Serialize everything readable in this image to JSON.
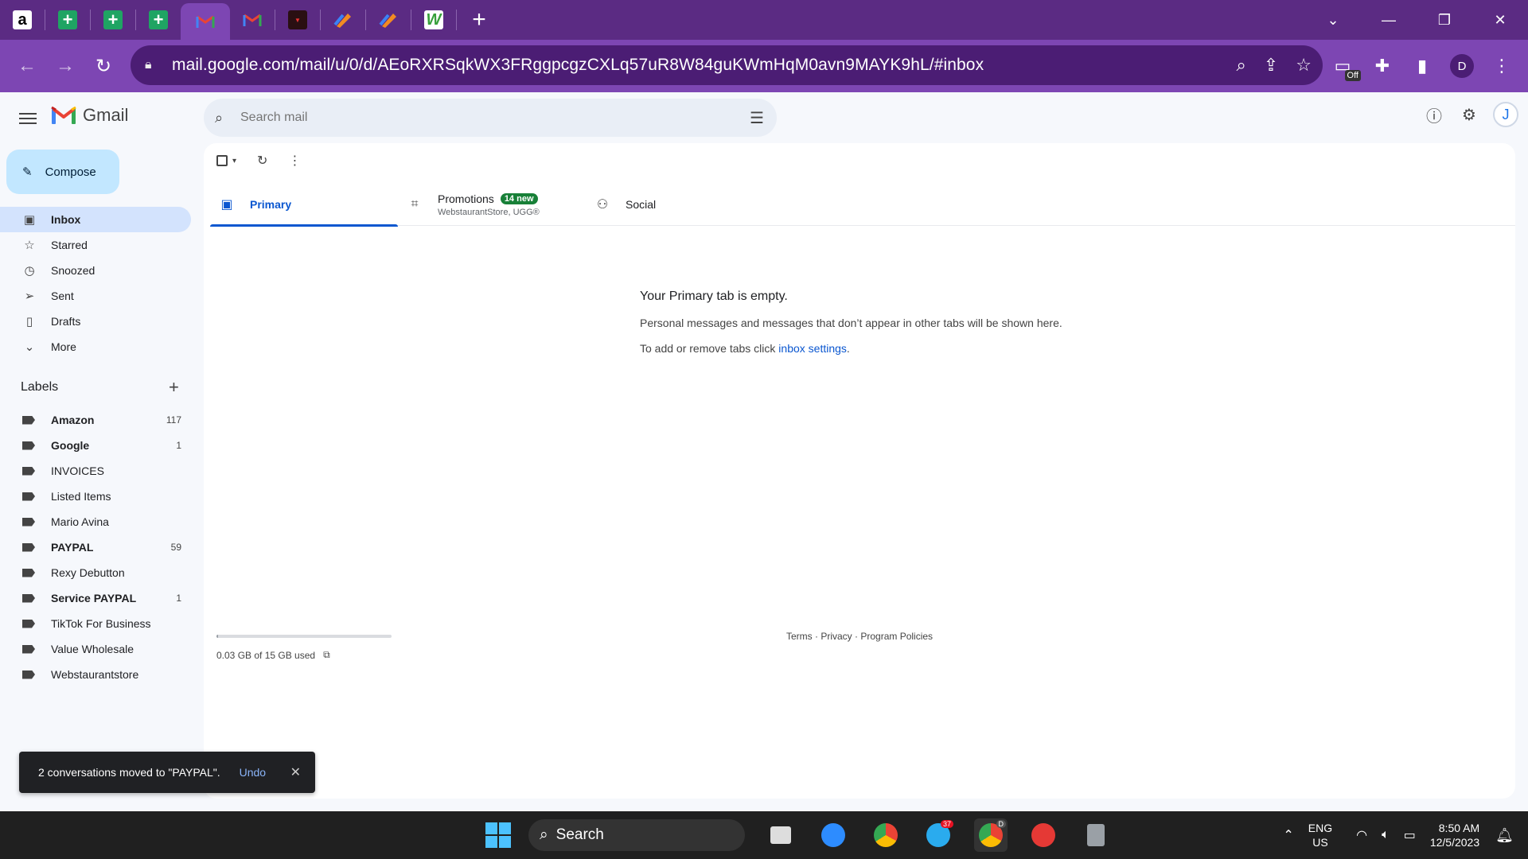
{
  "browser": {
    "url": "mail.google.com/mail/u/0/d/AEoRXRSqkWX3FRggpcgzCXLq57uR8W84guKWmHqM0avn9MAYK9hL/#inbox",
    "profile_initial": "D",
    "ext_off_badge": "Off",
    "tab_favicons": [
      "amazon",
      "sheets",
      "sheets",
      "sheets",
      "gmail",
      "gmail",
      "red-app",
      "pen-app",
      "pen-app",
      "green-app"
    ]
  },
  "gmail": {
    "logo_text": "Gmail",
    "search_placeholder": "Search mail",
    "account_initial": "J",
    "compose_label": "Compose",
    "nav": [
      {
        "label": "Inbox",
        "icon": "inbox-icon"
      },
      {
        "label": "Starred",
        "icon": "star-icon"
      },
      {
        "label": "Snoozed",
        "icon": "clock-icon"
      },
      {
        "label": "Sent",
        "icon": "send-icon"
      },
      {
        "label": "Drafts",
        "icon": "draft-icon"
      },
      {
        "label": "More",
        "icon": "chevron-down-icon"
      }
    ],
    "labels_heading": "Labels",
    "labels": [
      {
        "name": "Amazon",
        "count": "117"
      },
      {
        "name": "Google",
        "count": "1"
      },
      {
        "name": "INVOICES",
        "count": ""
      },
      {
        "name": "Listed Items",
        "count": ""
      },
      {
        "name": "Mario Avina",
        "count": ""
      },
      {
        "name": "PAYPAL",
        "count": "59"
      },
      {
        "name": "Rexy Debutton",
        "count": ""
      },
      {
        "name": "Service PAYPAL",
        "count": "1"
      },
      {
        "name": "TikTok For Business",
        "count": ""
      },
      {
        "name": "Value Wholesale",
        "count": ""
      },
      {
        "name": "Webstaurantstore",
        "count": ""
      }
    ],
    "tabs": {
      "primary": "Primary",
      "promotions": "Promotions",
      "promotions_badge": "14 new",
      "promotions_sub": "WebstaurantStore, UGG®",
      "social": "Social"
    },
    "empty": {
      "title": "Your Primary tab is empty.",
      "line1": "Personal messages and messages that don’t appear in other tabs will be shown here.",
      "line2_prefix": "To add or remove tabs click ",
      "line2_link": "inbox settings",
      "line2_suffix": "."
    },
    "storage": {
      "text": "0.03 GB of 15 GB used",
      "used_fraction": 0.002
    },
    "footer": {
      "terms": "Terms",
      "privacy": "Privacy",
      "policies": "Program Policies",
      "sep": " · "
    },
    "snackbar": {
      "message": "2 conversations moved to \"PAYPAL\".",
      "undo": "Undo"
    }
  },
  "taskbar": {
    "search_label": "Search",
    "telegram_badge": "37",
    "chrome_badge": "D",
    "lang_top": "ENG",
    "lang_bottom": "US",
    "time": "8:50 AM",
    "date": "12/5/2023"
  }
}
